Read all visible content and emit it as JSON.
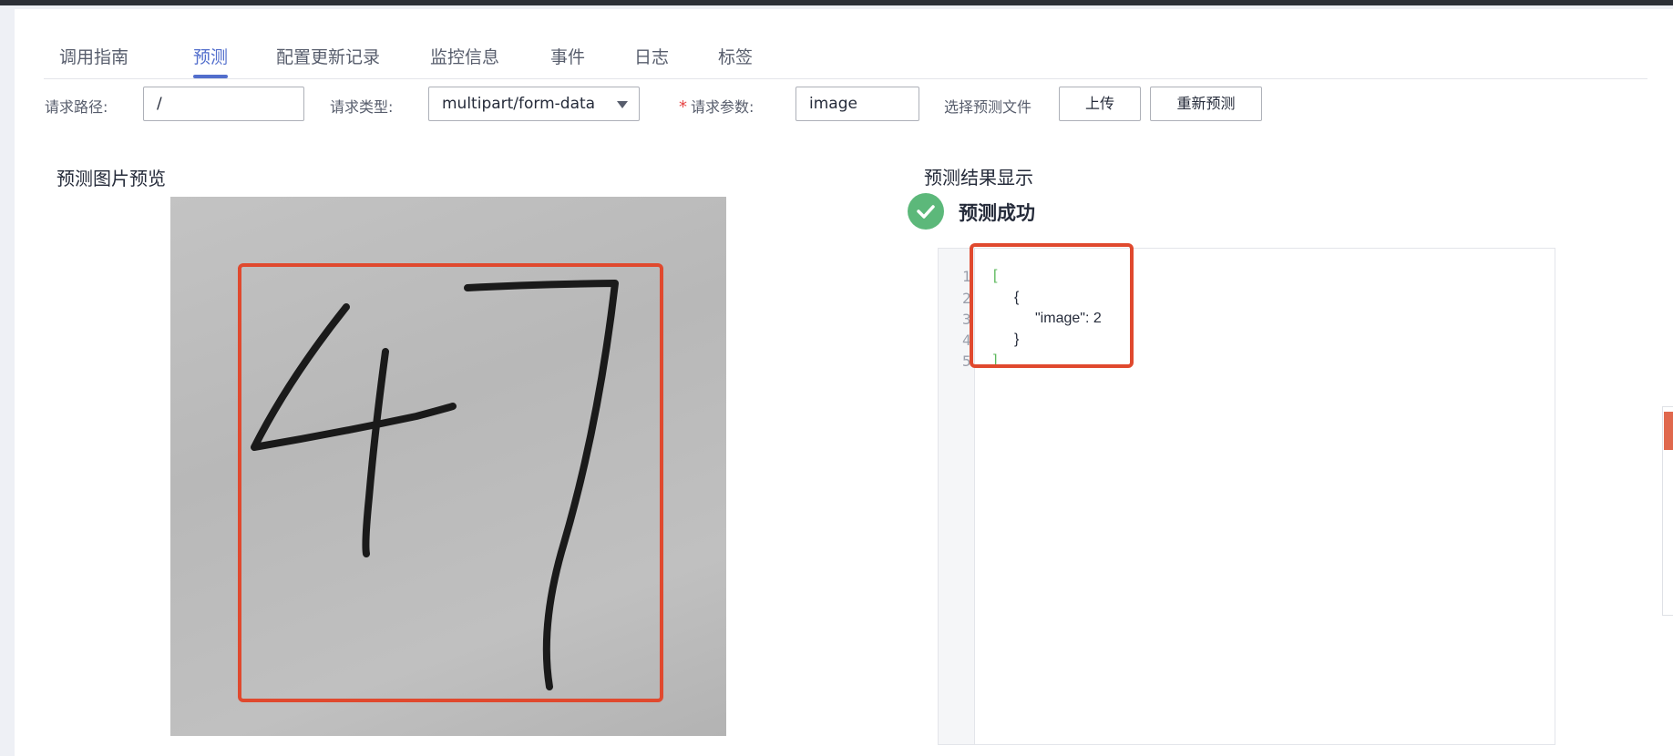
{
  "tabs": [
    {
      "label": "调用指南",
      "active": false
    },
    {
      "label": "预测",
      "active": true
    },
    {
      "label": "配置更新记录",
      "active": false
    },
    {
      "label": "监控信息",
      "active": false
    },
    {
      "label": "事件",
      "active": false
    },
    {
      "label": "日志",
      "active": false
    },
    {
      "label": "标签",
      "active": false
    }
  ],
  "form": {
    "path_label": "请求路径:",
    "path_value": "/",
    "type_label": "请求类型:",
    "type_value": "multipart/form-data",
    "param_required": "*",
    "param_label": "请求参数:",
    "param_value": "image",
    "file_label": "选择预测文件",
    "upload_button": "上传",
    "repredict_button": "重新预测"
  },
  "preview": {
    "title": "预测图片预览",
    "highlight_color": "#e0492e"
  },
  "result": {
    "title": "预测结果显示",
    "status": "预测成功",
    "status_color": "#5cb87a",
    "line_numbers": [
      "1",
      "2",
      "3",
      "4",
      "5"
    ],
    "lines": [
      "[",
      "{",
      "\"image\": 2",
      "}",
      "]"
    ]
  },
  "colors": {
    "accent": "#526ecc",
    "required": "#e64545",
    "highlight": "#e0492e"
  },
  "icons": {
    "dropdown": "chevron-down-icon",
    "success": "check-circle-icon"
  }
}
